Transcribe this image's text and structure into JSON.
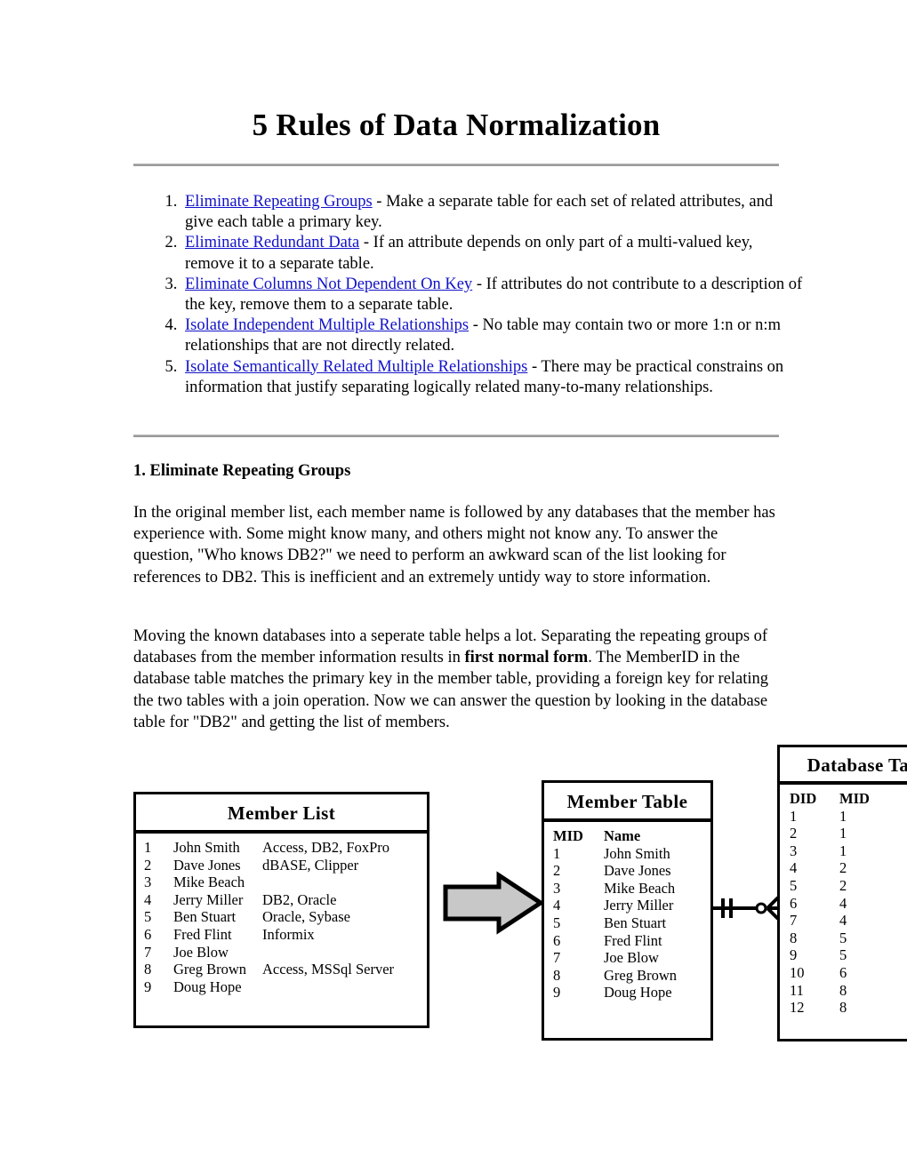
{
  "document": {
    "title": "5 Rules of Data Normalization"
  },
  "rules": [
    {
      "number": "1.",
      "link": "Eliminate Repeating Groups",
      "description": " - Make a separate table for each set of related attributes, and give each table a primary key."
    },
    {
      "number": "2.",
      "link": "Eliminate Redundant Data",
      "description": " - If an attribute depends on only part of a multi-valued key, remove it to a separate table."
    },
    {
      "number": "3.",
      "link": "Eliminate Columns Not Dependent On Key",
      "description": " - If attributes do not contribute to a description of the key, remove them to a separate table."
    },
    {
      "number": "4.",
      "link": "Isolate Independent Multiple Relationships",
      "description": " - No table may contain two or more 1:n or n:m relationships that are not directly related."
    },
    {
      "number": "5.",
      "link": "Isolate Semantically Related Multiple Relationships",
      "description": " - There may be practical constrains on information that justify separating logically related many-to-many relationships."
    }
  ],
  "section": {
    "heading": "1. Eliminate Repeating Groups",
    "paragraph_1": "In the original member list, each member name is followed by any databases that the member has experience with. Some might know many, and others might not know any. To answer the question, \"Who knows DB2?\" we need to perform an awkward scan of the list looking for references to DB2. This is inefficient and an extremely untidy way to store information.",
    "paragraph_2_before": "Moving the known databases into a seperate table helps a lot. Separating the repeating groups of databases from the member information results in ",
    "paragraph_2_bold": "first normal form",
    "paragraph_2_after": ". The MemberID in the database table matches the primary key in the member table, providing a foreign key for relating the two tables with a join operation. Now we can answer the question by looking in the database table for \"DB2\" and getting the list of members."
  },
  "diagram": {
    "member_list": {
      "title": "Member List",
      "rows": [
        {
          "id": "1",
          "name": "John Smith",
          "databases": "Access, DB2, FoxPro"
        },
        {
          "id": "2",
          "name": "Dave Jones",
          "databases": "dBASE, Clipper"
        },
        {
          "id": "3",
          "name": "Mike Beach",
          "databases": ""
        },
        {
          "id": "4",
          "name": "Jerry Miller",
          "databases": "DB2, Oracle"
        },
        {
          "id": "5",
          "name": "Ben Stuart",
          "databases": "Oracle, Sybase"
        },
        {
          "id": "6",
          "name": "Fred Flint",
          "databases": "Informix"
        },
        {
          "id": "7",
          "name": "Joe Blow",
          "databases": ""
        },
        {
          "id": "8",
          "name": "Greg Brown",
          "databases": "Access, MSSql Server"
        },
        {
          "id": "9",
          "name": "Doug Hope",
          "databases": ""
        }
      ]
    },
    "member_table": {
      "title": "Member Table",
      "headers": {
        "id": "MID",
        "name": "Name"
      },
      "rows": [
        {
          "id": "1",
          "name": "John Smith"
        },
        {
          "id": "2",
          "name": "Dave Jones"
        },
        {
          "id": "3",
          "name": "Mike Beach"
        },
        {
          "id": "4",
          "name": "Jerry Miller"
        },
        {
          "id": "5",
          "name": "Ben Stuart"
        },
        {
          "id": "6",
          "name": "Fred Flint"
        },
        {
          "id": "7",
          "name": "Joe Blow"
        },
        {
          "id": "8",
          "name": "Greg Brown"
        },
        {
          "id": "9",
          "name": "Doug Hope"
        }
      ]
    },
    "database_table": {
      "title": "Database Table",
      "headers": {
        "did": "DID",
        "mid": "MID"
      },
      "rows": [
        {
          "did": "1",
          "mid": "1"
        },
        {
          "did": "2",
          "mid": "1"
        },
        {
          "did": "3",
          "mid": "1"
        },
        {
          "did": "4",
          "mid": "2"
        },
        {
          "did": "5",
          "mid": "2"
        },
        {
          "did": "6",
          "mid": "4"
        },
        {
          "did": "7",
          "mid": "4"
        },
        {
          "did": "8",
          "mid": "5"
        },
        {
          "did": "9",
          "mid": "5"
        },
        {
          "did": "10",
          "mid": "6"
        },
        {
          "did": "11",
          "mid": "8"
        },
        {
          "did": "12",
          "mid": "8"
        }
      ]
    },
    "arrow": {
      "icon": "right-block-arrow-icon",
      "fill": "#c8c8c8",
      "stroke": "#000000"
    },
    "relationship": {
      "icon": "one-to-many-crowsfoot-icon",
      "left_cardinality": "one",
      "right_cardinality": "zero-or-many"
    }
  },
  "colors": {
    "link": "#1212c8",
    "rule": "#9a9a9a",
    "text": "#000000",
    "arrow_fill": "#c8c8c8"
  }
}
